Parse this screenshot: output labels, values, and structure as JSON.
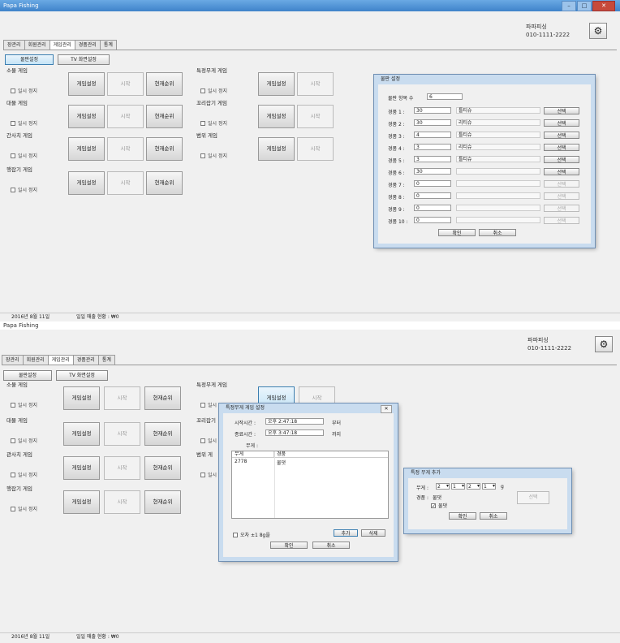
{
  "screens": [
    {
      "window_title": "Papa Fishing",
      "shop_name": "파파피싱",
      "shop_phone": "010-1111-2222",
      "tabs": [
        "장관리",
        "회원관리",
        "게임관리",
        "경품관리",
        "통계"
      ],
      "active_tab": 2,
      "top_buttons": [
        "물판설정",
        "TV 화면설정"
      ],
      "games": [
        {
          "title": "소물 게임",
          "pause": "일시 정지",
          "btns": [
            "게임설정",
            "시작",
            "현재순위"
          ]
        },
        {
          "title": "대물 게임",
          "pause": "일시 정지",
          "btns": [
            "게임설정",
            "시작",
            "현재순위"
          ]
        },
        {
          "title": "간사치 게임",
          "pause": "일시 정지",
          "btns": [
            "게임설정",
            "시작",
            "현재순위"
          ]
        },
        {
          "title": "행잡기 게임",
          "pause": "일시 정지",
          "btns": [
            "게임설정",
            "시작",
            "현재순위"
          ]
        }
      ],
      "games_right": [
        {
          "title": "특정무게 게임",
          "pause": "일시 정지",
          "btns": [
            "게임설정",
            "시작"
          ]
        },
        {
          "title": "꼬리잡기 게임",
          "pause": "일시 정지",
          "btns": [
            "게임설정",
            "시작"
          ]
        },
        {
          "title": "범위 게임",
          "pause": "일시 정지",
          "btns": [
            "게임설정",
            "시작"
          ]
        }
      ],
      "status": {
        "date": "2016년 8월 11일",
        "sales": "일일 매출 현황 : ₩0"
      }
    },
    {
      "window_title": "Papa Fishing",
      "shop_name": "파파피싱",
      "shop_phone": "010-1111-2222",
      "tabs": [
        "장관리",
        "회원관리",
        "게임관리",
        "경품관리",
        "통계"
      ],
      "active_tab": 2,
      "top_buttons": [
        "물판설정",
        "TV 화면설정"
      ],
      "games": [
        {
          "title": "소물 게임",
          "pause": "일시 정지",
          "btns": [
            "게임설정",
            "시작",
            "현재순위"
          ]
        },
        {
          "title": "대물 게임",
          "pause": "일시 정지",
          "btns": [
            "게임설정",
            "시작",
            "현재순위"
          ]
        },
        {
          "title": "관사치 게임",
          "pause": "일시 정지",
          "btns": [
            "게임설정",
            "시작",
            "현재순위"
          ]
        },
        {
          "title": "행잡기 게임",
          "pause": "일시 정지",
          "btns": [
            "게임설정",
            "시작",
            "현재순위"
          ]
        }
      ],
      "games_right": [
        {
          "title": "특정무게 게임",
          "pause": "일시",
          "btns": [
            "게임설정",
            "시작"
          ]
        },
        {
          "title": "꼬리잡기",
          "pause": "일시",
          "btns": []
        },
        {
          "title": "범위 게",
          "pause": "일시",
          "btns": []
        }
      ],
      "status": {
        "date": "2016년 8월 11일",
        "sales": "일일 매출 현황 : ₩0"
      }
    }
  ],
  "prize_dialog": {
    "title": "물판 설정",
    "count_label": "물판 항목 수",
    "count_value": "6",
    "rows": [
      {
        "label": "경품 1 :",
        "value": "30",
        "prize": "틀티슈",
        "btn": "선택",
        "enabled": true
      },
      {
        "label": "경품 2 :",
        "value": "30",
        "prize": "리티슈",
        "btn": "선택",
        "enabled": true
      },
      {
        "label": "경품 3 :",
        "value": "4",
        "prize": "틀티슈",
        "btn": "선택",
        "enabled": true
      },
      {
        "label": "경품 4 :",
        "value": "3",
        "prize": "리티슈",
        "btn": "선택",
        "enabled": true
      },
      {
        "label": "경품 5 :",
        "value": "3",
        "prize": "틀티슈",
        "btn": "선택",
        "enabled": true
      },
      {
        "label": "경품 6 :",
        "value": "30",
        "prize": "",
        "btn": "선택",
        "enabled": true
      },
      {
        "label": "경품 7 :",
        "value": "0",
        "prize": "",
        "btn": "선택",
        "enabled": false
      },
      {
        "label": "경품 8 :",
        "value": "0",
        "prize": "",
        "btn": "선택",
        "enabled": false
      },
      {
        "label": "경품 9 :",
        "value": "0",
        "prize": "",
        "btn": "선택",
        "enabled": false
      },
      {
        "label": "경품 10 :",
        "value": "0",
        "prize": "",
        "btn": "선택",
        "enabled": false
      }
    ],
    "ok": "확인",
    "cancel": "취소"
  },
  "weight_dialog": {
    "title": "특정무게 게임 설정",
    "start_label": "시작시간 :",
    "start_value": "오후  2:47:18",
    "start_suffix": "부터",
    "end_label": "종료시간 :",
    "end_value": "오후  3:47:18",
    "end_suffix": "까지",
    "weight_label": "무게 :",
    "table_headers": [
      "무게",
      "경품"
    ],
    "table_rows": [
      [
        "2778",
        "물댓"
      ]
    ],
    "tolerance": "오차 ±1 8g을",
    "add": "추가",
    "delete": "삭제",
    "ok": "확인",
    "cancel": "취소"
  },
  "add_weight_dialog": {
    "title": "특정 무게 추가",
    "weight_label": "무게 :",
    "digits": [
      "2",
      "1",
      "2",
      "1"
    ],
    "unit": "g",
    "prize_label": "경품 :",
    "prize_value": "물댓",
    "check_label": "물댓",
    "select": "선택",
    "ok": "확인",
    "cancel": "취소"
  }
}
